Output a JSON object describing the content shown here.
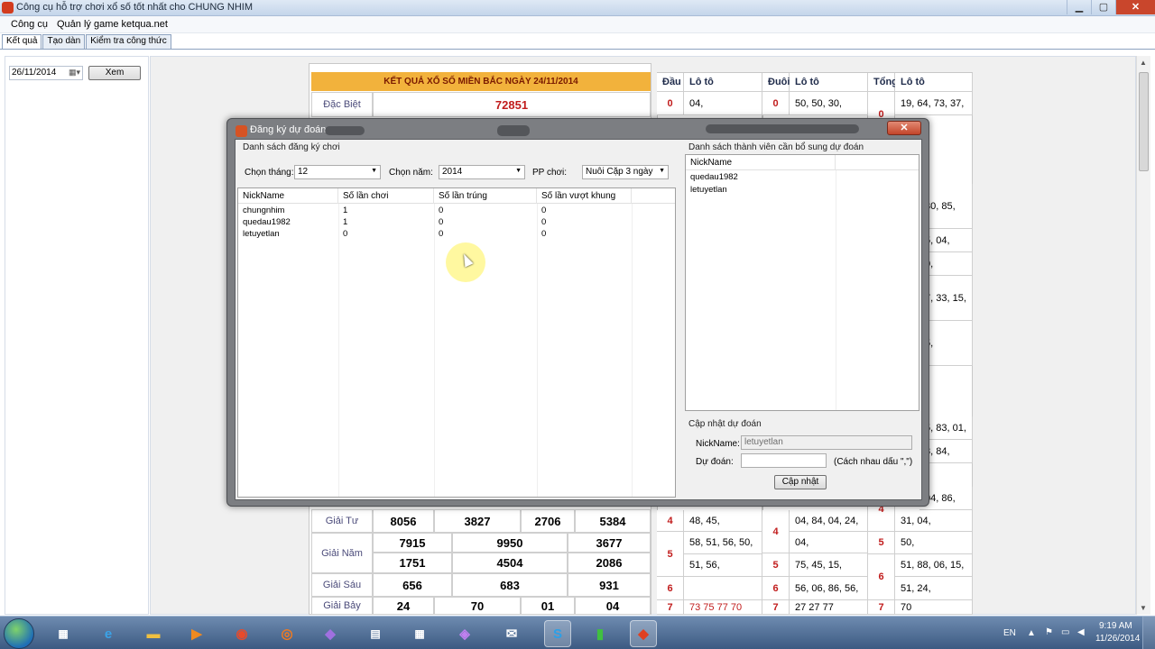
{
  "window": {
    "title": "Công cụ hỗ trợ chơi xổ số tốt nhất cho CHUNG NHIM",
    "minimize": "▁",
    "maximize": "▢",
    "close": "✕"
  },
  "menu": [
    "Công cụ",
    "Quản lý game ketqua.net"
  ],
  "tabs": [
    "Kết quả",
    "Tạo dàn",
    "Kiểm tra công thức"
  ],
  "left": {
    "date": "26/11/2014",
    "view_button": "Xem"
  },
  "results": {
    "header": "KẾT QUẢ XỔ SỐ MIỀN BẮC NGÀY 24/11/2014",
    "special_label": "Đặc Biệt",
    "special_value": "72851",
    "prize4_label": "Giải Tư",
    "prize4": [
      "8056",
      "3827",
      "2706",
      "5384"
    ],
    "prize5_label": "Giải Năm",
    "prize5_row1": [
      "7915",
      "9950",
      "3677"
    ],
    "prize5_row2": [
      "1751",
      "4504",
      "2086"
    ],
    "prize6_label": "Giải Sáu",
    "prize6": [
      "656",
      "683",
      "931"
    ],
    "prize7_label": "Giải Bảy",
    "prize7": [
      "24",
      "70",
      "01",
      "04"
    ]
  },
  "loto": {
    "col_dau": "Đầu",
    "col_loto": "Lô tô",
    "col_duoi": "Đuôi",
    "col_tong": "Tổng",
    "row0": {
      "dau": "0",
      "dau_loto": "04,",
      "duoi": "0",
      "duoi_loto": "50, 50, 30,",
      "tong": "0",
      "tong_loto": "19, 64, 73, 37,"
    },
    "tong_partial": [
      "30, 85,",
      "5, 04,",
      "0,",
      "7, 33, 15,",
      "5,",
      "5, 83, 01,",
      "3, 84,",
      "04, 86,"
    ],
    "row4": {
      "dau": "4",
      "dau_loto": "48, 45,",
      "duoi": "4",
      "duoi_loto": "04, 84, 04, 24,",
      "duoi_loto2": "04,",
      "tong": "4",
      "tong_loto": "31, 04,"
    },
    "row5": {
      "dau": "5",
      "dau_loto": "58, 51, 56, 50,",
      "dau_loto2": "51, 56,",
      "duoi": "5",
      "duoi_loto": "75, 45, 15,",
      "tong": "5",
      "tong_loto": "50,"
    },
    "row6": {
      "dau": "6",
      "duoi": "6",
      "duoi_loto": "56, 06, 86, 56,",
      "tong": "6",
      "tong_loto": "51, 88, 06, 15,",
      "tong_loto2": "51, 24,"
    },
    "row7": {
      "dau": "7",
      "dau_loto": "73 75 77 70",
      "duoi": "7",
      "duoi_loto": "27 27 77",
      "tong": "7",
      "tong_loto": "70"
    }
  },
  "dialog": {
    "title": "Đăng ký dự đoán",
    "close": "✕",
    "left_group": "Danh sách đăng ký chơi",
    "month_label": "Chọn tháng:",
    "month_value": "12",
    "year_label": "Chọn năm:",
    "year_value": "2014",
    "pp_label": "PP chơi:",
    "pp_value": "Nuôi Cặp 3 ngày",
    "grid_columns": [
      "NickName",
      "Số lần chơi",
      "Số lần trúng",
      "Số lần vượt khung"
    ],
    "grid_rows": [
      [
        "chungnhim",
        "1",
        "0",
        "0"
      ],
      [
        "quedau1982",
        "1",
        "0",
        "0"
      ],
      [
        "letuyetlan",
        "0",
        "0",
        "0"
      ]
    ],
    "right_group": "Danh sách thành viên cần bổ sung dự đoán",
    "member_column": "NickName",
    "members": [
      "quedau1982",
      "letuyetlan"
    ],
    "update_group": "Cập nhật dự đoán",
    "nick_label": "NickName:",
    "nick_value": "letuyetlan",
    "predict_label": "Dự đoán:",
    "predict_value": "",
    "hint": "(Cách nhau dấu \",\")",
    "update_button": "Cập nhật"
  },
  "taskbar": {
    "lang": "EN",
    "time": "9:19 AM",
    "date": "11/26/2014"
  }
}
